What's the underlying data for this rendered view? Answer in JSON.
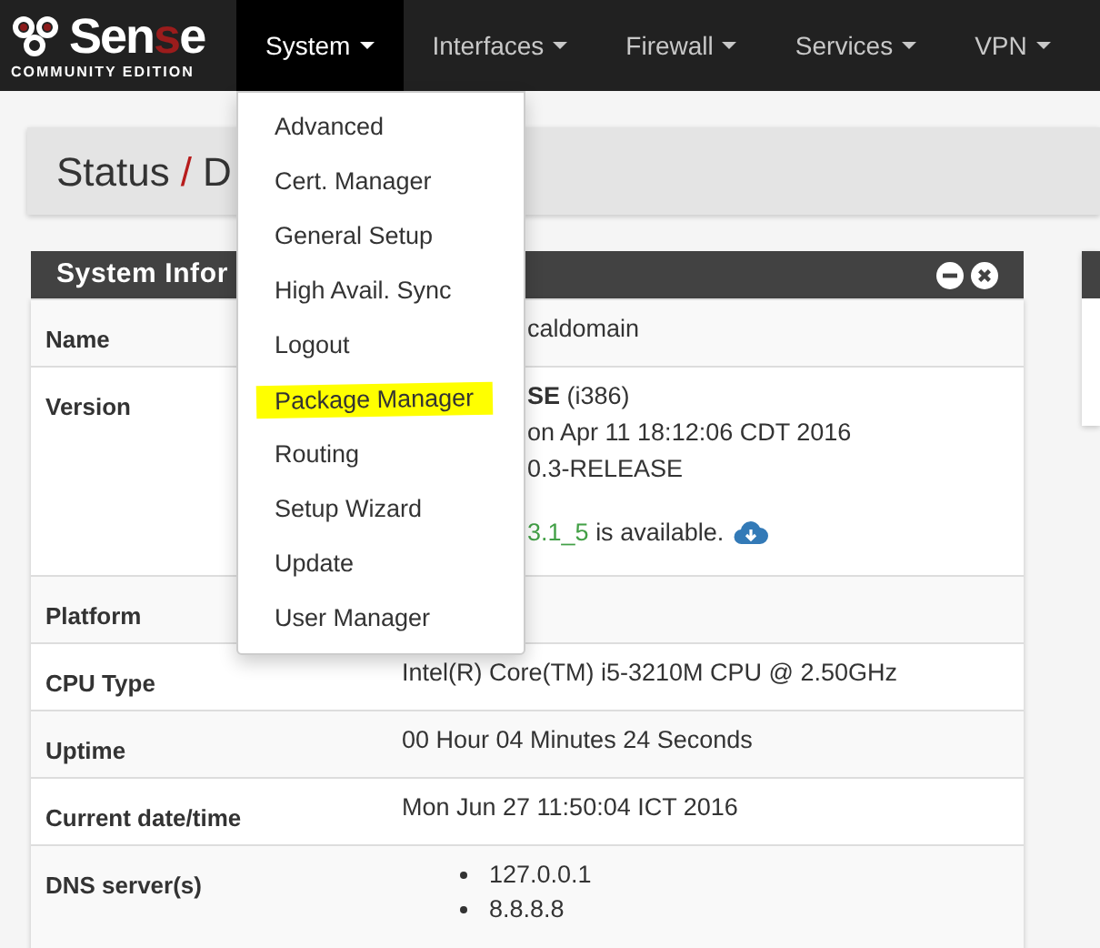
{
  "logo": {
    "parts": [
      {
        "text": "Sen",
        "accent": false
      },
      {
        "text": "s",
        "accent": true
      },
      {
        "text": "e",
        "accent": false
      }
    ],
    "subtitle": "COMMUNITY EDITION"
  },
  "nav": [
    {
      "label": "System",
      "selected": true
    },
    {
      "label": "Interfaces",
      "selected": false
    },
    {
      "label": "Firewall",
      "selected": false
    },
    {
      "label": "Services",
      "selected": false
    },
    {
      "label": "VPN",
      "selected": false
    }
  ],
  "menu": [
    {
      "label": "Advanced",
      "highlighted": false
    },
    {
      "label": "Cert. Manager",
      "highlighted": false
    },
    {
      "label": "General Setup",
      "highlighted": false
    },
    {
      "label": "High Avail. Sync",
      "highlighted": false
    },
    {
      "label": "Logout",
      "highlighted": false
    },
    {
      "label": "Package Manager",
      "highlighted": true
    },
    {
      "label": "Routing",
      "highlighted": false
    },
    {
      "label": "Setup Wizard",
      "highlighted": false
    },
    {
      "label": "Update",
      "highlighted": false
    },
    {
      "label": "User Manager",
      "highlighted": false
    }
  ],
  "breadcrumb": {
    "parent": "Status",
    "separator": "/",
    "current": "D"
  },
  "panel": {
    "title": "System Infor",
    "rows": [
      {
        "label": "Name",
        "kind": "covered",
        "lines": [
          "caldomain"
        ]
      },
      {
        "label": "Version",
        "kind": "version",
        "lines": [
          "**SE** (i386)",
          "on Apr 11 18:12:06 CDT 2016",
          "0.3-RELEASE"
        ],
        "update": {
          "version": "3.1_5",
          "text": "is available."
        }
      },
      {
        "label": "Platform",
        "kind": "text",
        "lines": []
      },
      {
        "label": "CPU Type",
        "kind": "text",
        "lines": [
          "Intel(R) Core(TM) i5-3210M CPU @ 2.50GHz"
        ]
      },
      {
        "label": "Uptime",
        "kind": "text",
        "lines": [
          "00 Hour 04 Minutes 24 Seconds"
        ]
      },
      {
        "label": "Current date/time",
        "kind": "text",
        "lines": [
          "Mon Jun 27 11:50:04 ICT 2016"
        ]
      },
      {
        "label": "DNS server(s)",
        "kind": "list",
        "lines": [
          "127.0.0.1",
          "8.8.8.8"
        ]
      }
    ]
  }
}
